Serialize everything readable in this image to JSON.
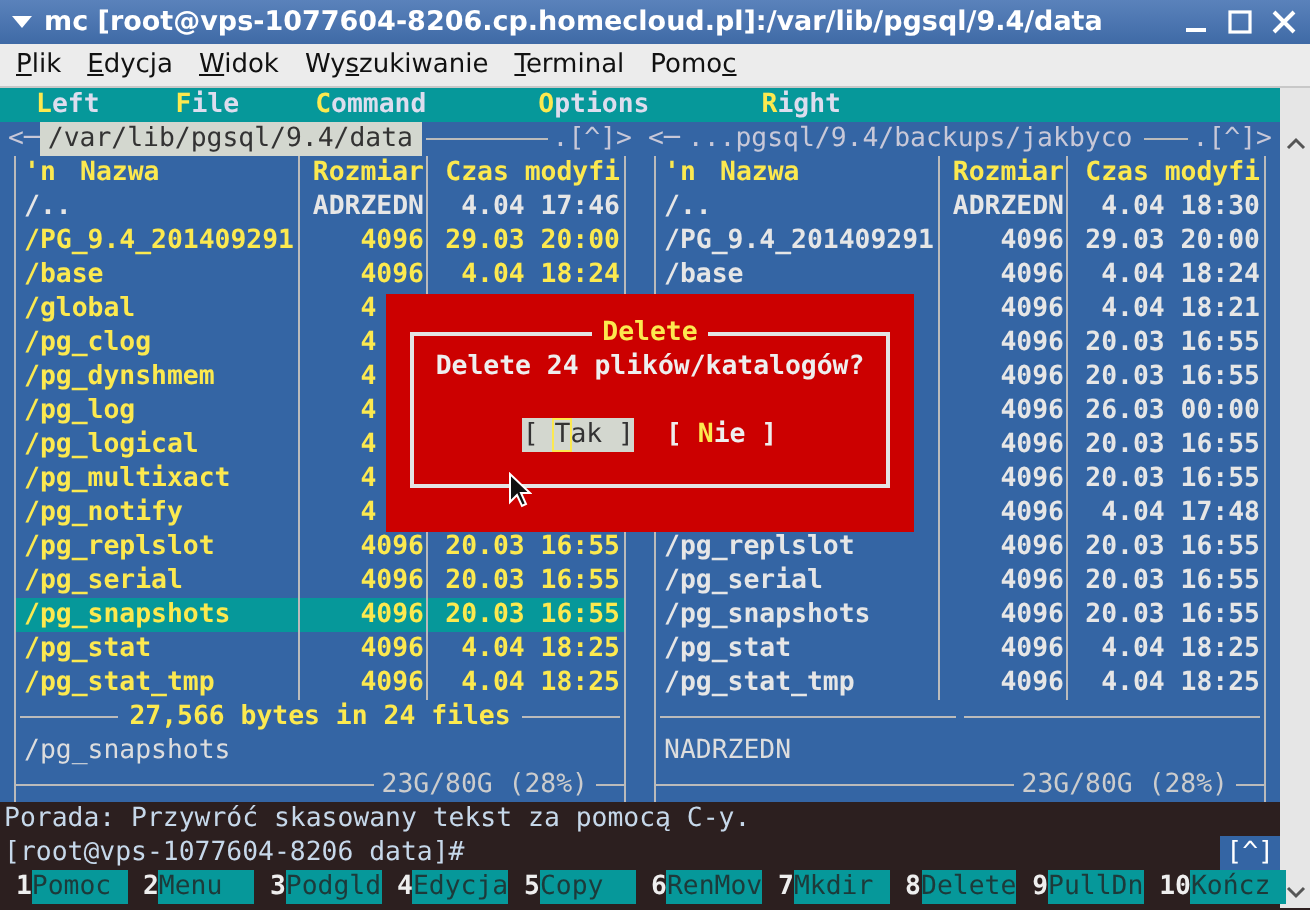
{
  "window": {
    "title": "mc [root@vps-1077604-8206.cp.homecloud.pl]:/var/lib/pgsql/9.4/data"
  },
  "menubar": [
    {
      "key": "P",
      "after": "lik"
    },
    {
      "key": "E",
      "after": "dycja"
    },
    {
      "key": "W",
      "after": "idok"
    },
    {
      "before": "Wy",
      "key": "s",
      "after": "zukiwanie"
    },
    {
      "key": "T",
      "after": "erminal"
    },
    {
      "before": "Pomo",
      "key": "c"
    }
  ],
  "mc_menu": [
    {
      "key": "L",
      "rest": "eft"
    },
    {
      "key": "F",
      "rest": "ile"
    },
    {
      "key": "C",
      "rest": "ommand"
    },
    {
      "key": "O",
      "rest": "ptions"
    },
    {
      "key": "R",
      "rest": "ight"
    }
  ],
  "panels": [
    {
      "active": true,
      "left_marker": "<─",
      "path": "/var/lib/pgsql/9.4/data",
      "right_marker": ".[^]>",
      "columns": [
        "'n",
        "Nazwa",
        "Rozmiar",
        "Czas modyfi"
      ],
      "rows": [
        {
          "name": "/..",
          "size": "ADRZEDN",
          "time": "4.04 17:46",
          "marked": false,
          "selected": false
        },
        {
          "name": "/PG_9.4_201409291",
          "size": "4096",
          "time": "29.03 20:00",
          "marked": true,
          "selected": false
        },
        {
          "name": "/base",
          "size": "4096",
          "time": "4.04 18:24",
          "marked": true,
          "selected": false
        },
        {
          "name": "/global",
          "size": "4",
          "marked": true,
          "selected": false
        },
        {
          "name": "/pg_clog",
          "size": "4",
          "marked": true,
          "selected": false
        },
        {
          "name": "/pg_dynshmem",
          "size": "4",
          "marked": true,
          "selected": false
        },
        {
          "name": "/pg_log",
          "size": "4",
          "marked": true,
          "selected": false
        },
        {
          "name": "/pg_logical",
          "size": "4",
          "marked": true,
          "selected": false
        },
        {
          "name": "/pg_multixact",
          "size": "4",
          "marked": true,
          "selected": false
        },
        {
          "name": "/pg_notify",
          "size": "4",
          "marked": true,
          "selected": false
        },
        {
          "name": "/pg_replslot",
          "size": "4096",
          "time": "20.03 16:55",
          "marked": true,
          "selected": false
        },
        {
          "name": "/pg_serial",
          "size": "4096",
          "time": "20.03 16:55",
          "marked": true,
          "selected": false
        },
        {
          "name": "/pg_snapshots",
          "size": "4096",
          "time": "20.03 16:55",
          "marked": true,
          "selected": true
        },
        {
          "name": "/pg_stat",
          "size": "4096",
          "time": "4.04 18:25",
          "marked": true,
          "selected": false
        },
        {
          "name": "/pg_stat_tmp",
          "size": "4096",
          "time": "4.04 18:25",
          "marked": true,
          "selected": false
        }
      ],
      "summary": "27,566 bytes in 24 files",
      "mini_status": "/pg_snapshots",
      "disk": "23G/80G (28%)"
    },
    {
      "active": false,
      "left_marker": "<─",
      "path": "...pgsql/9.4/backups/jakbyco",
      "right_marker": ".[^]>",
      "columns": [
        "'n",
        "Nazwa",
        "Rozmiar",
        "Czas modyfi"
      ],
      "rows": [
        {
          "name": "/..",
          "size": "ADRZEDN",
          "time": "4.04 18:30",
          "marked": false,
          "selected": false
        },
        {
          "name": "/PG_9.4_201409291",
          "size": "4096",
          "time": "29.03 20:00",
          "marked": false,
          "selected": false
        },
        {
          "name": "/base",
          "size": "4096",
          "time": "4.04 18:24",
          "marked": false,
          "selected": false
        },
        {
          "size": "4096",
          "time": "4.04 18:21",
          "marked": false,
          "selected": false
        },
        {
          "size": "4096",
          "time": "20.03 16:55",
          "marked": false,
          "selected": false
        },
        {
          "size": "4096",
          "time": "20.03 16:55",
          "marked": false,
          "selected": false
        },
        {
          "size": "4096",
          "time": "26.03 00:00",
          "marked": false,
          "selected": false
        },
        {
          "size": "4096",
          "time": "20.03 16:55",
          "marked": false,
          "selected": false
        },
        {
          "size": "4096",
          "time": "20.03 16:55",
          "marked": false,
          "selected": false
        },
        {
          "size": "4096",
          "time": "4.04 17:48",
          "marked": false,
          "selected": false
        },
        {
          "name": "/pg_replslot",
          "size": "4096",
          "time": "20.03 16:55",
          "marked": false,
          "selected": false
        },
        {
          "name": "/pg_serial",
          "size": "4096",
          "time": "20.03 16:55",
          "marked": false,
          "selected": false
        },
        {
          "name": "/pg_snapshots",
          "size": "4096",
          "time": "20.03 16:55",
          "marked": false,
          "selected": false
        },
        {
          "name": "/pg_stat",
          "size": "4096",
          "time": "4.04 18:25",
          "marked": false,
          "selected": false
        },
        {
          "name": "/pg_stat_tmp",
          "size": "4096",
          "time": "4.04 18:25",
          "marked": false,
          "selected": false
        }
      ],
      "mini_status": "NADRZEDN",
      "disk": "23G/80G (28%)"
    }
  ],
  "dialog": {
    "title": "Delete",
    "message": "Delete 24 plików/katalogów?",
    "buttons": [
      {
        "open": "[ ",
        "key": "T",
        "rest": "ak ]",
        "selected": true
      },
      {
        "open": "[ ",
        "key": "N",
        "rest": "ie ]",
        "selected": false
      }
    ]
  },
  "hint": "Porada: Przywróć skasowany tekst za pomocą C-y.",
  "prompt": "[root@vps-1077604-8206 data]#",
  "prompt_badge": "[^]",
  "fkeys": [
    {
      "num": "1",
      "label": "Pomoc"
    },
    {
      "num": "2",
      "label": "Menu"
    },
    {
      "num": "3",
      "label": "Podgld"
    },
    {
      "num": "4",
      "label": "Edycja"
    },
    {
      "num": "5",
      "label": "Copy"
    },
    {
      "num": "6",
      "label": "RenMov"
    },
    {
      "num": "7",
      "label": "Mkdir"
    },
    {
      "num": "8",
      "label": "Delete"
    },
    {
      "num": "9",
      "label": "PullDn"
    },
    {
      "num": "10",
      "label": "Kończ"
    }
  ]
}
